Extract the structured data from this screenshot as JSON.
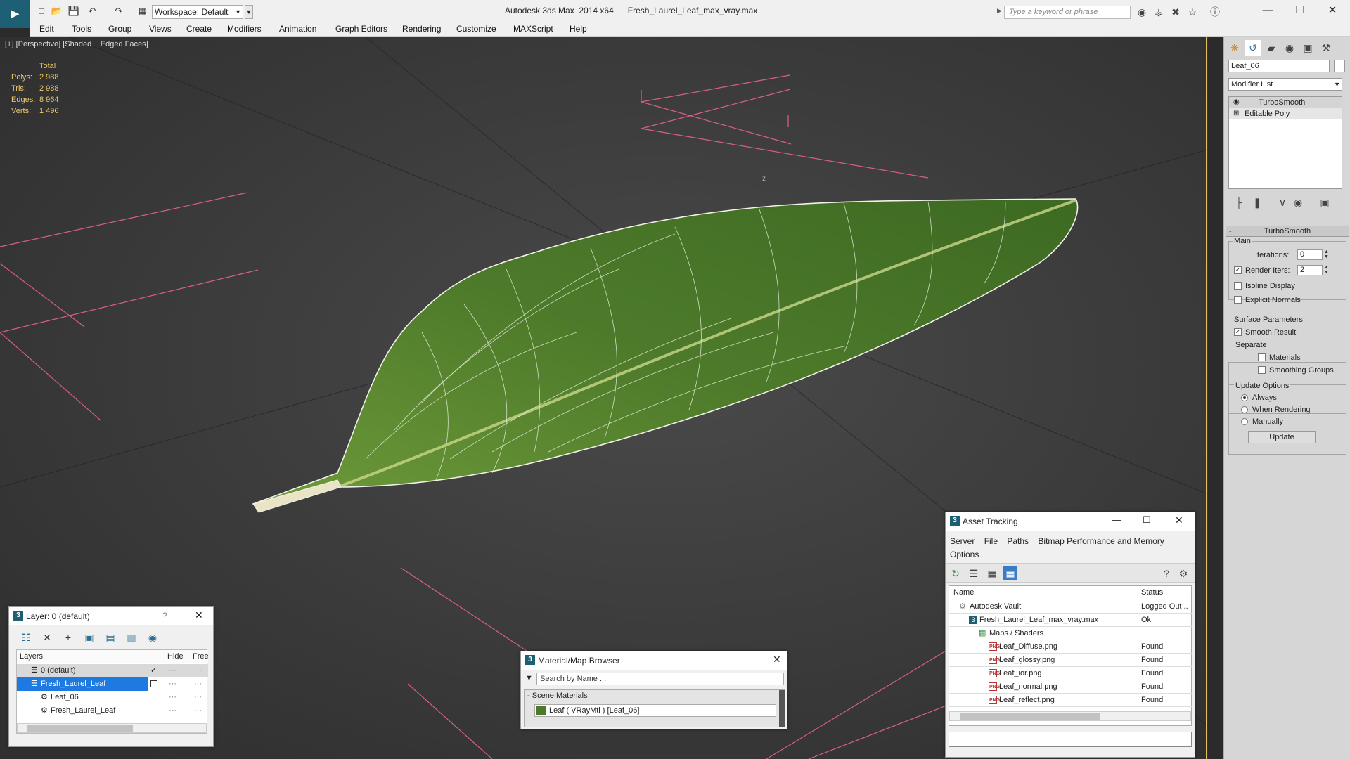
{
  "window": {
    "app_title": "Autodesk 3ds Max  2014 x64",
    "file_title": "Fresh_Laurel_Leaf_max_vray.max",
    "workspace": "Workspace: Default",
    "search_placeholder": "Type a keyword or phrase"
  },
  "menu": [
    "Edit",
    "Tools",
    "Group",
    "Views",
    "Create",
    "Modifiers",
    "Animation",
    "Graph Editors",
    "Rendering",
    "Customize",
    "MAXScript",
    "Help"
  ],
  "viewport": {
    "label": "[+] [Perspective] [Shaded + Edged Faces]",
    "stats_header": "Total",
    "stats": [
      {
        "key": "Polys:",
        "value": "2 988"
      },
      {
        "key": "Tris:",
        "value": "2 988"
      },
      {
        "key": "Edges:",
        "value": "8 964"
      },
      {
        "key": "Verts:",
        "value": "1 496"
      }
    ],
    "axis_label": "z"
  },
  "command_panel": {
    "object_name": "Leaf_06",
    "modifier_list": "Modifier List",
    "stack": [
      "TurboSmooth",
      "Editable Poly"
    ],
    "rollout_title": "TurboSmooth",
    "main_label": "Main",
    "iterations_label": "Iterations:",
    "iterations_value": "0",
    "render_iters_label": "Render Iters:",
    "render_iters_value": "2",
    "isoline_label": "Isoline Display",
    "explicit_normals_label": "Explicit Normals",
    "surface_params_label": "Surface Parameters",
    "smooth_result_label": "Smooth Result",
    "separate_label": "Separate",
    "materials_label": "Materials",
    "smoothing_groups_label": "Smoothing Groups",
    "update_options_label": "Update Options",
    "always_label": "Always",
    "when_rendering_label": "When Rendering",
    "manually_label": "Manually",
    "update_button": "Update"
  },
  "layer_panel": {
    "title": "Layer: 0 (default)",
    "help": "?",
    "col_layers": "Layers",
    "col_hide": "Hide",
    "col_freeze": "Free",
    "rows": [
      "0 (default)",
      "Fresh_Laurel_Leaf",
      "Leaf_06",
      "Fresh_Laurel_Leaf"
    ]
  },
  "material_browser": {
    "title": "Material/Map Browser",
    "search_placeholder": "Search by Name ...",
    "section": "Scene Materials",
    "item": "Leaf  ( VRayMtl )  [Leaf_06]"
  },
  "asset_tracking": {
    "title": "Asset Tracking",
    "menu": [
      "Server",
      "File",
      "Paths",
      "Bitmap Performance and Memory",
      "Options"
    ],
    "col_name": "Name",
    "col_status": "Status",
    "rows": [
      {
        "name": "Autodesk Vault",
        "status": "Logged Out ..",
        "indent": 1,
        "icon": "vault"
      },
      {
        "name": "Fresh_Laurel_Leaf_max_vray.max",
        "status": "Ok",
        "indent": 2,
        "icon": "max"
      },
      {
        "name": "Maps / Shaders",
        "status": "",
        "indent": 3,
        "icon": "maps"
      },
      {
        "name": "Leaf_Diffuse.png",
        "status": "Found",
        "indent": 4,
        "icon": "png"
      },
      {
        "name": "Leaf_glossy.png",
        "status": "Found",
        "indent": 4,
        "icon": "png"
      },
      {
        "name": "Leaf_ior.png",
        "status": "Found",
        "indent": 4,
        "icon": "png"
      },
      {
        "name": "Leaf_normal.png",
        "status": "Found",
        "indent": 4,
        "icon": "png"
      },
      {
        "name": "Leaf_reflect.png",
        "status": "Found",
        "indent": 4,
        "icon": "png"
      }
    ],
    "png_badge": "PNG"
  },
  "colors": {
    "accent": "#1d5f73",
    "stats": "#e9c96b",
    "grid_pink": "#d9607f",
    "leaf": "#4d7a2a"
  }
}
